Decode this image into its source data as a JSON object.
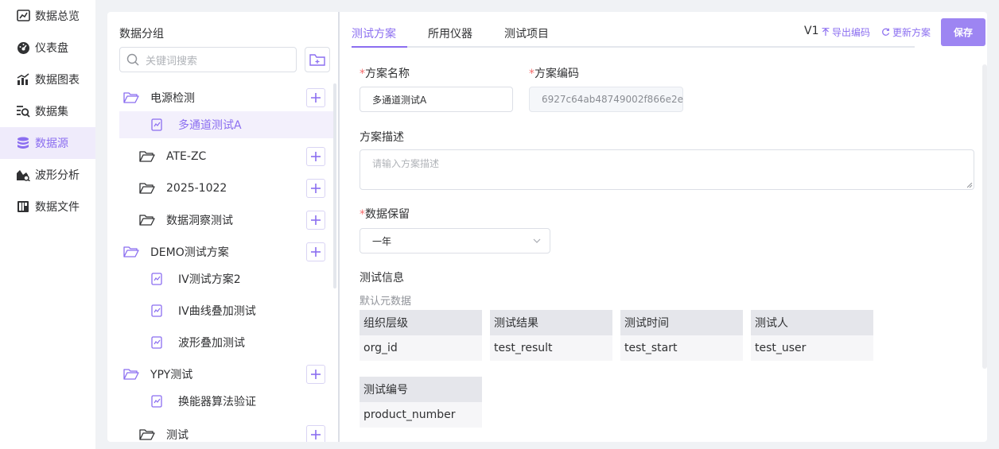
{
  "nav": {
    "items": [
      {
        "label": "数据总览",
        "icon": "dashboard-chart-icon"
      },
      {
        "label": "仪表盘",
        "icon": "gauge-icon"
      },
      {
        "label": "数据图表",
        "icon": "bar-chart-icon"
      },
      {
        "label": "数据集",
        "icon": "dataset-search-icon"
      },
      {
        "label": "数据源",
        "icon": "database-icon",
        "active": true
      },
      {
        "label": "波形分析",
        "icon": "waveform-icon"
      },
      {
        "label": "数据文件",
        "icon": "data-file-icon"
      }
    ]
  },
  "tree": {
    "title": "数据分组",
    "search_placeholder": "关键词搜索",
    "rows": [
      {
        "label": "电源检测",
        "type": "group"
      },
      {
        "label": "多通道测试A",
        "type": "leaf",
        "selected": true
      },
      {
        "label": "ATE-ZC",
        "type": "group"
      },
      {
        "label": "2025-1022",
        "type": "group"
      },
      {
        "label": "数据洞察测试",
        "type": "group"
      },
      {
        "label": "DEMO测试方案",
        "type": "group"
      },
      {
        "label": "IV测试方案2",
        "type": "leaf"
      },
      {
        "label": "IV曲线叠加测试",
        "type": "leaf"
      },
      {
        "label": "波形叠加测试",
        "type": "leaf"
      },
      {
        "label": "YPY测试",
        "type": "group"
      },
      {
        "label": "换能器算法验证",
        "type": "leaf"
      },
      {
        "label": "测试",
        "type": "group"
      }
    ]
  },
  "tabs": [
    {
      "label": "测试方案",
      "active": true
    },
    {
      "label": "所用仪器"
    },
    {
      "label": "测试项目"
    }
  ],
  "header": {
    "version": "V1",
    "export_label": "导出编码",
    "update_label": "更新方案",
    "save_label": "保存"
  },
  "form": {
    "required_mark": "*",
    "name_label": "方案名称",
    "name_value": "多通道测试A",
    "code_label": "方案编码",
    "code_value": "6927c64ab48749002f866e2e",
    "desc_label": "方案描述",
    "desc_placeholder": "请输入方案描述",
    "retention_label": "数据保留",
    "retention_value": "一年",
    "test_info_label": "测试信息",
    "default_meta_label": "默认元数据",
    "meta": [
      {
        "title": "组织层级",
        "key": "org_id"
      },
      {
        "title": "测试结果",
        "key": "test_result"
      },
      {
        "title": "测试时间",
        "key": "test_start"
      },
      {
        "title": "测试人",
        "key": "test_user"
      },
      {
        "title": "测试编号",
        "key": "product_number"
      }
    ]
  },
  "colors": {
    "accent": "#8b6ef0",
    "save_button": "#9d85f2",
    "required": "#f56c6c"
  }
}
